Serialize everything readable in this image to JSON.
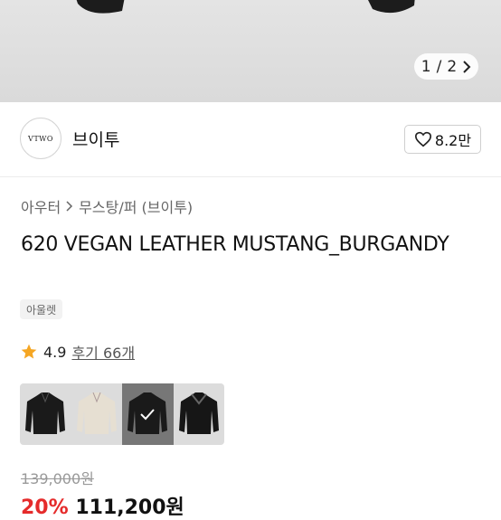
{
  "gallery": {
    "current": "1",
    "separator": "/",
    "total": "2",
    "next_icon": "chevron-right-icon"
  },
  "seller": {
    "logo_text": "VTWO",
    "name": "브이투",
    "likes": "8.2만"
  },
  "breadcrumb": {
    "category": "아우터",
    "subcategory": "무스탕/퍼 (브이투)"
  },
  "product": {
    "title": "620 VEGAN LEATHER MUSTANG_BURGANDY",
    "badge": "아울렛",
    "rating": "4.9",
    "reviews": "후기 66개",
    "original_price": "139,000원",
    "discount_rate": "20%",
    "sale_price": "111,200원"
  },
  "swatches": [
    {
      "color": "black leather"
    },
    {
      "color": "beige"
    },
    {
      "color": "black",
      "selected": true
    },
    {
      "color": "black shearling"
    }
  ],
  "colors": {
    "star": "#f5a623",
    "sale": "#e52b2b"
  }
}
